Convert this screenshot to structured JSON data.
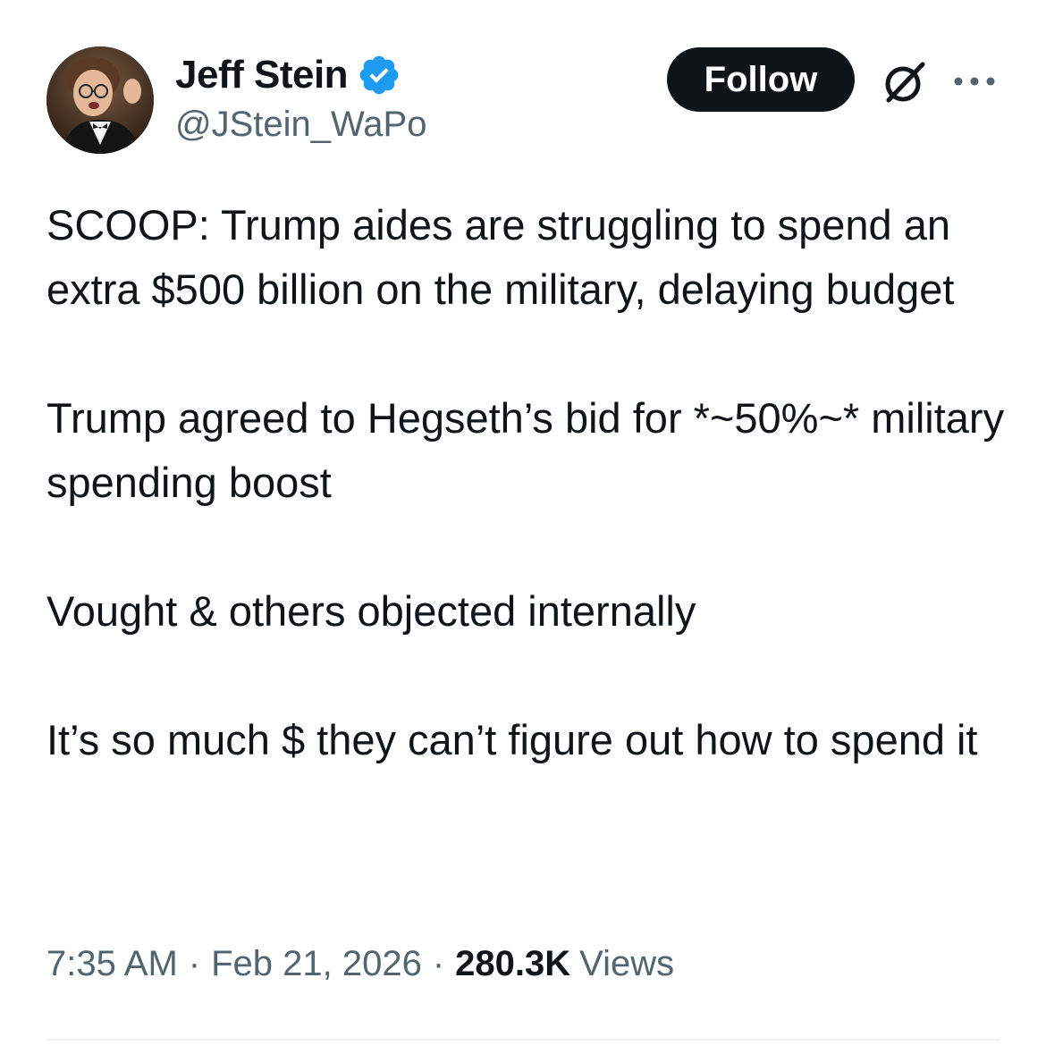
{
  "author": {
    "display_name": "Jeff Stein",
    "handle": "@JStein_WaPo",
    "verified": true,
    "verified_color": "#1d9bf0"
  },
  "actions": {
    "follow_label": "Follow",
    "grok_icon": "grok-icon",
    "more_icon": "more-icon"
  },
  "tweet": {
    "paragraphs": [
      "SCOOP: Trump aides are struggling to spend an extra $500 billion on the military, delaying budget",
      "Trump agreed to Hegseth’s bid for *~50%~* military spending boost",
      "Vought & others objected internally",
      "It’s so much $ they can’t figure out how to spend it"
    ]
  },
  "meta": {
    "time": "7:35 AM",
    "separator": "·",
    "date": "Feb 21, 2026",
    "views_count": "280.3K",
    "views_label": "Views"
  },
  "colors": {
    "text": "#0f1419",
    "secondary": "#536471",
    "follow_bg": "#0f1419",
    "divider": "#eff3f4"
  }
}
